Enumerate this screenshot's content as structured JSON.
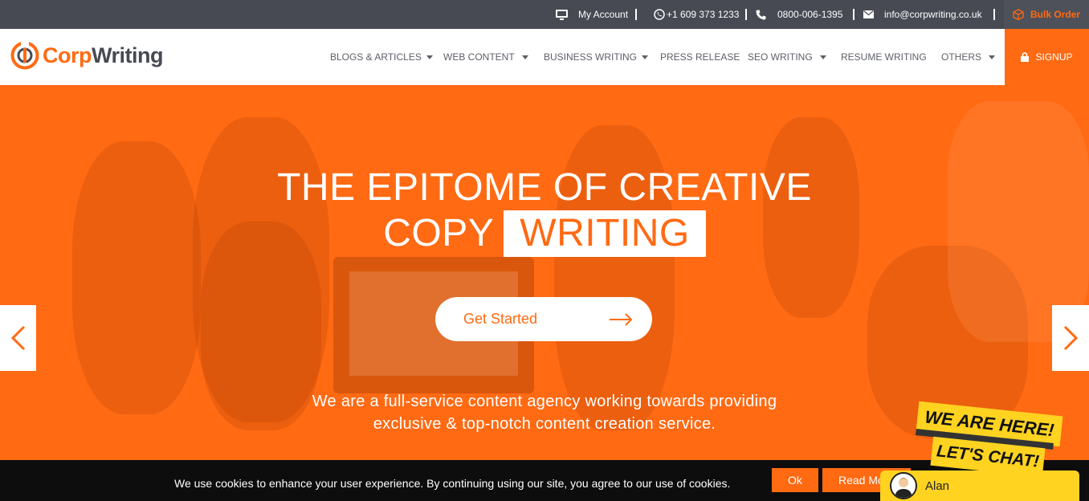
{
  "topbar": {
    "my_account": "My Account",
    "phone_whatsapp": "+1 609 373 1233",
    "phone": "0800-006-1395",
    "email": "info@corpwriting.co.uk",
    "bulk_order": "Bulk Order"
  },
  "brand": {
    "name_part1": "Corp",
    "name_part2": "Writing",
    "accent_color": "#ff6a13",
    "dark_color": "#474a53"
  },
  "nav": {
    "items": [
      {
        "label": "BLOGS & ARTICLES",
        "dropdown": true
      },
      {
        "label": "WEB CONTENT",
        "dropdown": true
      },
      {
        "label": "BUSINESS WRITING",
        "dropdown": true
      },
      {
        "label": "PRESS RELEASE",
        "dropdown": false
      },
      {
        "label": "SEO WRITING",
        "dropdown": true
      },
      {
        "label": "RESUME WRITING",
        "dropdown": false
      },
      {
        "label": "OTHERS",
        "dropdown": true
      }
    ],
    "signup": "SIGNUP"
  },
  "hero": {
    "headline_line1": "THE EPITOME OF CREATIVE",
    "headline_line2_prefix": "COPY",
    "headline_highlight": "WRITING",
    "cta_label": "Get Started",
    "tagline_line1": "We are a full-service content agency working towards providing",
    "tagline_line2": "exclusive & top-notch content creation service."
  },
  "cookie": {
    "text": "We use cookies to enhance your user experience. By continuing using our site, you agree to our use of cookies.",
    "ok_label": "Ok",
    "read_more_label": "Read More"
  },
  "chat": {
    "banner_line1": "WE ARE HERE!",
    "banner_line2": "LET'S CHAT!",
    "agent_name": "Alan"
  }
}
